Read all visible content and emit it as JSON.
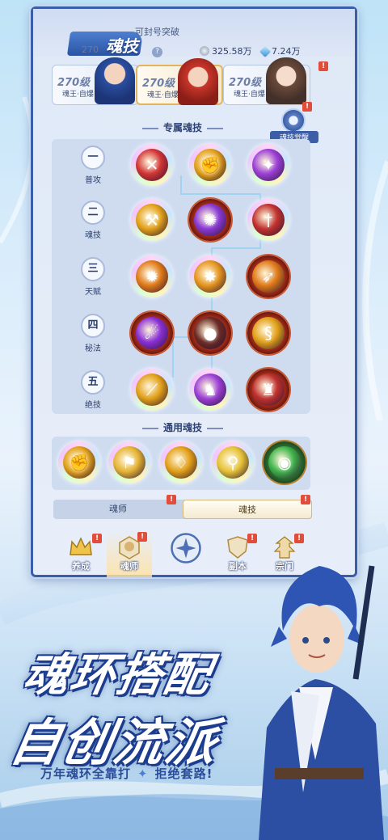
{
  "header": {
    "title": "魂技",
    "sub_caption": "可封号突破",
    "level_prefix": "270",
    "resources": [
      {
        "icon": "silver-coin-icon",
        "value": "325.58万"
      },
      {
        "icon": "diamond-icon",
        "value": "7.24万"
      }
    ]
  },
  "heroes": [
    {
      "level": "270级",
      "role": "魂王·自爆",
      "portrait": "blue-hair-hero"
    },
    {
      "level": "270级",
      "role": "魂王·自爆",
      "portrait": "red-hair-hero",
      "active": true
    },
    {
      "level": "270级",
      "role": "魂王·自爆",
      "portrait": "brown-hair-heroine"
    }
  ],
  "awaken_button": {
    "label": "魂技觉醒",
    "icon": "awaken-emblem-icon"
  },
  "exclusive_section": {
    "title": "专属魂技",
    "tiers": [
      {
        "num": "一",
        "name": "普攻"
      },
      {
        "num": "二",
        "name": "魂技"
      },
      {
        "num": "三",
        "name": "天赋"
      },
      {
        "num": "四",
        "name": "秘法"
      },
      {
        "num": "五",
        "name": "绝技"
      }
    ],
    "skills": [
      [
        {
          "style": "rainbow",
          "color": "#d23434",
          "icon": "crossed-swords-icon"
        },
        {
          "style": "rainbow",
          "color": "#e2a018",
          "icon": "fist-icon"
        },
        {
          "style": "rainbow",
          "color": "#9b3fd6",
          "icon": "purple-flame-icon"
        }
      ],
      [
        {
          "style": "rainbow",
          "color": "#e2a018",
          "icon": "hammer-icon"
        },
        {
          "style": "red",
          "color": "#8a39d6",
          "icon": "violet-claw-icon"
        },
        {
          "style": "rainbow",
          "color": "#c0312e",
          "icon": "blood-sword-icon"
        }
      ],
      [
        {
          "style": "rainbow",
          "color": "#e07a18",
          "icon": "fire-burst-icon"
        },
        {
          "style": "rainbow",
          "color": "#e6951e",
          "icon": "explosion-icon"
        },
        {
          "style": "red",
          "color": "#e07a18",
          "icon": "arrow-burst-icon"
        }
      ],
      [
        {
          "style": "red",
          "color": "#8a2fd6",
          "icon": "meteor-icon"
        },
        {
          "style": "red",
          "color": "#6b2a24",
          "icon": "dark-orb-icon"
        },
        {
          "style": "red",
          "color": "#e2a018",
          "icon": "golden-dragon-icon"
        }
      ],
      [
        {
          "style": "rainbow",
          "color": "#e2a018",
          "icon": "golden-blade-icon"
        },
        {
          "style": "rainbow",
          "color": "#9b3fd6",
          "icon": "shadow-figure-icon"
        },
        {
          "style": "red",
          "color": "#c0312e",
          "icon": "crimson-warrior-icon"
        }
      ]
    ]
  },
  "common_section": {
    "title": "通用魂技",
    "skills": [
      {
        "style": "rainbow",
        "color": "#e2a018",
        "icon": "golden-fist-icon"
      },
      {
        "style": "rainbow",
        "color": "#e6b436",
        "icon": "golden-wing-icon"
      },
      {
        "style": "rainbow",
        "color": "#e2a018",
        "icon": "golden-bell-icon"
      },
      {
        "style": "rainbow",
        "color": "#e6c236",
        "icon": "golden-mace-icon"
      },
      {
        "style": "green",
        "color": "#3fb44a",
        "icon": "green-eye-icon"
      }
    ]
  },
  "toggle": {
    "options": [
      "魂师",
      "魂技"
    ],
    "selected": 1
  },
  "navbar": {
    "items": [
      {
        "label": "养成",
        "icon": "crown-icon",
        "badge": true
      },
      {
        "label": "魂师",
        "icon": "portrait-frame-icon",
        "badge": true,
        "active": true
      },
      {
        "label": "",
        "icon": "center-emblem-icon",
        "badge": false
      },
      {
        "label": "副本",
        "icon": "shield-icon",
        "badge": true
      },
      {
        "label": "宗门",
        "icon": "pagoda-icon",
        "badge": true
      }
    ]
  },
  "promo": {
    "line1": "魂环搭配",
    "line2": "自创流派",
    "tagline_left": "万年魂环全靠打",
    "tagline_right": "拒绝套路!"
  },
  "colors": {
    "frame": "#3a5fa8",
    "accent_gold": "#e4b45a",
    "badge_red": "#e24c3a"
  }
}
